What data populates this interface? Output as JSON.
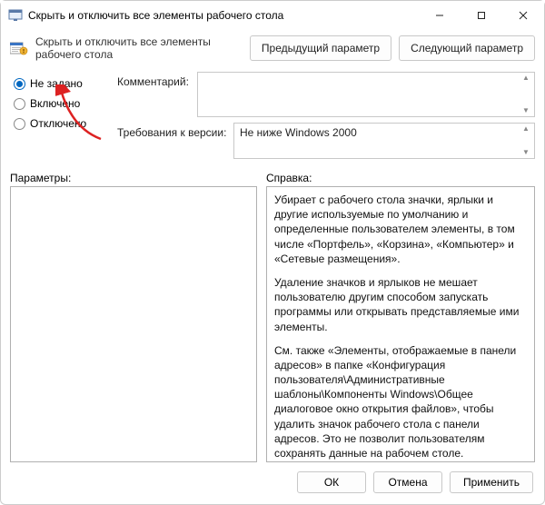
{
  "window": {
    "title": "Скрыть и отключить все элементы рабочего стола"
  },
  "header": {
    "policy_title": "Скрыть и отключить все элементы рабочего стола",
    "prev": "Предыдущий параметр",
    "next": "Следующий параметр"
  },
  "radio": {
    "not_configured": "Не задано",
    "enabled": "Включено",
    "disabled": "Отключено",
    "selected": "not_configured"
  },
  "fields": {
    "comment_label": "Комментарий:",
    "comment_value": "",
    "requirements_label": "Требования к версии:",
    "requirements_value": "Не ниже Windows 2000"
  },
  "split": {
    "params_label": "Параметры:",
    "help_label": "Справка:"
  },
  "help": {
    "p1": "Убирает с рабочего стола значки, ярлыки и другие используемые по умолчанию и определенные пользователем элементы, в том числе «Портфель», «Корзина», «Компьютер» и «Сетевые размещения».",
    "p2": "Удаление значков и ярлыков не мешает пользователю другим способом запускать программы или открывать представляемые ими элементы.",
    "p3": "См. также «Элементы, отображаемые в панели адресов» в папке «Конфигурация пользователя\\Административные шаблоны\\Компоненты Windows\\Общее диалоговое окно открытия файлов», чтобы удалить значок рабочего стола с панели адресов. Это не позволит пользователям сохранять данные на рабочем столе."
  },
  "footer": {
    "ok": "ОК",
    "cancel": "Отмена",
    "apply": "Применить"
  }
}
